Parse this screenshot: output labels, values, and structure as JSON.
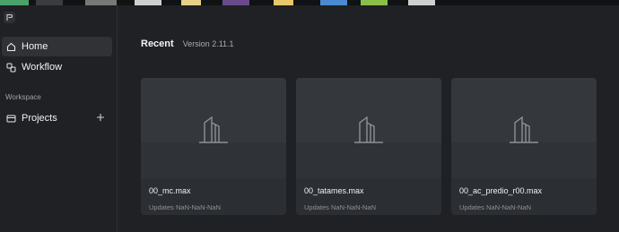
{
  "sidebar": {
    "nav": [
      {
        "label": "Home",
        "icon": "home-icon",
        "active": true
      },
      {
        "label": "Workflow",
        "icon": "workflow-icon",
        "active": false
      }
    ],
    "section_label": "Workspace",
    "projects": {
      "label": "Projects",
      "icon": "folder-icon",
      "add_icon": "plus-icon"
    }
  },
  "main": {
    "title": "Recent",
    "version": "Version 2.11.1",
    "cards": [
      {
        "name": "00_mc.max",
        "updated": "Updates NaN-NaN-NaN",
        "icon": "building-icon"
      },
      {
        "name": "00_tatames.max",
        "updated": "Updates NaN-NaN-NaN",
        "icon": "building-icon"
      },
      {
        "name": "00_ac_predio_r00.max",
        "updated": "Updates NaN-NaN-NaN",
        "icon": "building-icon"
      }
    ]
  },
  "colors": {
    "background": "#1f2124",
    "active_nav": "#303236",
    "card": "#2b2e32",
    "thumb": "#34373b"
  }
}
